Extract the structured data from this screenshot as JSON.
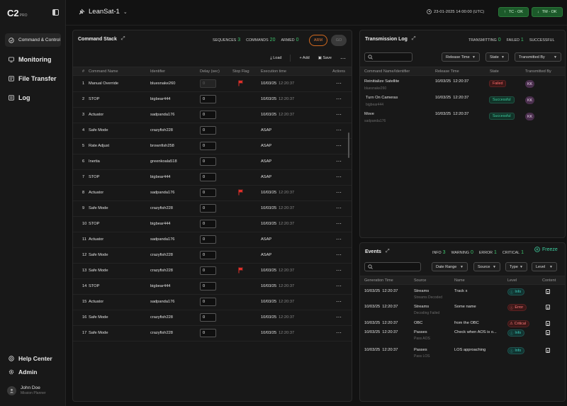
{
  "app": {
    "logo": "C2",
    "logo_badge": "PRO"
  },
  "sidebar": {
    "items": [
      {
        "label": "Command & Control",
        "icon": "command-icon",
        "active": true
      },
      {
        "label": "Monitoring",
        "icon": "monitor-icon"
      },
      {
        "label": "File Transfer",
        "icon": "file-transfer-icon"
      },
      {
        "label": "Log",
        "icon": "log-icon"
      }
    ],
    "bottom": [
      {
        "label": "Help Center",
        "icon": "help-icon"
      },
      {
        "label": "Admin",
        "icon": "gear-icon"
      }
    ],
    "user": {
      "name": "John Doe",
      "role": "Mission Planner"
    }
  },
  "topbar": {
    "satellite": "LeanSat-1",
    "datetime": "23-01-2025 14:00:00 (UTC)",
    "tc_status": "TC - OK",
    "tm_status": "TM - OK"
  },
  "command_stack": {
    "title": "Command Stack",
    "stats": {
      "sequences_label": "SEQUENCES",
      "sequences": "3",
      "commands_label": "COMMANDS",
      "commands": "20",
      "armed_label": "ARMED",
      "armed": "0"
    },
    "arm_label": "ARM",
    "go_label": "GO",
    "toolbar": {
      "load": "Load",
      "add": "Add",
      "save": "Save"
    },
    "columns": [
      "#",
      "Command Name",
      "Identifier",
      "Delay (sec)",
      "Stop Flag",
      "Execution time",
      "Actions"
    ],
    "rows": [
      {
        "n": "1",
        "name": "Manual Override",
        "id": "bluesnake260",
        "delay": "0",
        "flag": true,
        "date": "10/03/25",
        "time": "12:20:37",
        "disabled": true
      },
      {
        "n": "2",
        "name": "STOP",
        "id": "bigbear444",
        "delay": "0",
        "flag": false,
        "date": "10/03/25",
        "time": "12:20:37"
      },
      {
        "n": "3",
        "name": "Actuator",
        "id": "sadpanda176",
        "delay": "0",
        "flag": false,
        "date": "10/03/25",
        "time": "12:20:37"
      },
      {
        "n": "4",
        "name": "Safe Mode",
        "id": "crazyfish228",
        "delay": "0",
        "flag": false,
        "date": "ASAP",
        "time": ""
      },
      {
        "n": "5",
        "name": "Rate Adjust",
        "id": "brownfish258",
        "delay": "0",
        "flag": false,
        "date": "ASAP",
        "time": ""
      },
      {
        "n": "6",
        "name": "Inertia",
        "id": "greenkoala518",
        "delay": "0",
        "flag": false,
        "date": "ASAP",
        "time": ""
      },
      {
        "n": "7",
        "name": "STOP",
        "id": "bigbear444",
        "delay": "0",
        "flag": false,
        "date": "ASAP",
        "time": ""
      },
      {
        "n": "8",
        "name": "Actuator",
        "id": "sadpanda176",
        "delay": "0",
        "flag": true,
        "date": "10/03/25",
        "time": "12:20:37"
      },
      {
        "n": "9",
        "name": "Safe Mode",
        "id": "crazyfish228",
        "delay": "0",
        "flag": false,
        "date": "10/03/25",
        "time": "12:20:37"
      },
      {
        "n": "10",
        "name": "STOP",
        "id": "bigbear444",
        "delay": "0",
        "flag": false,
        "date": "10/03/25",
        "time": "12:20:37"
      },
      {
        "n": "11",
        "name": "Actuator",
        "id": "sadpanda176",
        "delay": "0",
        "flag": false,
        "date": "ASAP",
        "time": ""
      },
      {
        "n": "12",
        "name": "Safe Mode",
        "id": "crazyfish228",
        "delay": "0",
        "flag": false,
        "date": "ASAP",
        "time": ""
      },
      {
        "n": "13",
        "name": "Safe Mode",
        "id": "crazyfish228",
        "delay": "0",
        "flag": true,
        "date": "10/03/25",
        "time": "12:20:37"
      },
      {
        "n": "14",
        "name": "STOP",
        "id": "bigbear444",
        "delay": "0",
        "flag": false,
        "date": "10/03/25",
        "time": "12:20:37"
      },
      {
        "n": "15",
        "name": "Actuator",
        "id": "sadpanda176",
        "delay": "0",
        "flag": false,
        "date": "10/03/25",
        "time": "12:20:37"
      },
      {
        "n": "16",
        "name": "Safe Mode",
        "id": "crazyfish228",
        "delay": "0",
        "flag": false,
        "date": "10/03/25",
        "time": "12:20:37"
      },
      {
        "n": "17",
        "name": "Safe Mode",
        "id": "crazyfish228",
        "delay": "0",
        "flag": false,
        "date": "10/03/25",
        "time": "12:20:37"
      }
    ]
  },
  "transmission_log": {
    "title": "Transmission Log",
    "stats": {
      "transmitting_label": "TRANSMITTING",
      "transmitting": "0",
      "failed_label": "FAILED",
      "failed": "1",
      "successful_label": "SUCCESSFUL"
    },
    "filters": [
      "Release Time",
      "State",
      "Transmitted By"
    ],
    "columns": [
      "Command Name/Identifier",
      "Release Time",
      "State",
      "Transmitted By"
    ],
    "rows": [
      {
        "name": "Reinitialize Satellite",
        "id": "bluesnake260",
        "time": "10/03/25  12:20:37",
        "state": "Failed",
        "by": "KK"
      },
      {
        "name": "Turn On Cameras",
        "id": "bigbear444",
        "time": "10/03/25  12:20:37",
        "state": "Successful",
        "by": "KK"
      },
      {
        "name": "Move",
        "id": "sadpanda176",
        "time": "10/03/25  12:20:37",
        "state": "Successful",
        "by": "KK"
      }
    ]
  },
  "events": {
    "title": "Events",
    "stats": {
      "info_label": "INFO",
      "info": "3",
      "warning_label": "WARNING",
      "warning": "0",
      "error_label": "ERROR",
      "error": "1",
      "critical_label": "CRITICAL",
      "critical": "1"
    },
    "freeze_label": "Freeze",
    "filters": [
      "Date Range",
      "Source",
      "Type",
      "Level"
    ],
    "columns": [
      "Generation Time",
      "Source",
      "Name",
      "Level",
      "Content"
    ],
    "rows": [
      {
        "time": "10/03/25  12:20:37",
        "source": "Streams",
        "source_sub": "Streams Decoded",
        "name": "Track x",
        "level": "Info"
      },
      {
        "time": "10/03/25  12:20:37",
        "source": "Streams",
        "source_sub": "Decoding Failed",
        "name": "Some name",
        "level": "Error"
      },
      {
        "time": "10/03/25  12:20:37",
        "source": "OBC",
        "source_sub": "",
        "name": "from the OBC",
        "level": "Critical"
      },
      {
        "time": "10/03/25  12:20:37",
        "source": "Passes",
        "source_sub": "Pass AOS",
        "name": "Check when AOS is o...",
        "level": "Info"
      },
      {
        "time": "10/03/25  12:20:37",
        "source": "Passes",
        "source_sub": "Pass LOS",
        "name": "LOS approaching",
        "level": "Info"
      }
    ]
  },
  "colors": {
    "accent_green": "#3ec46d",
    "arm_orange": "#e07a3a",
    "flag_red": "#e0302a"
  }
}
